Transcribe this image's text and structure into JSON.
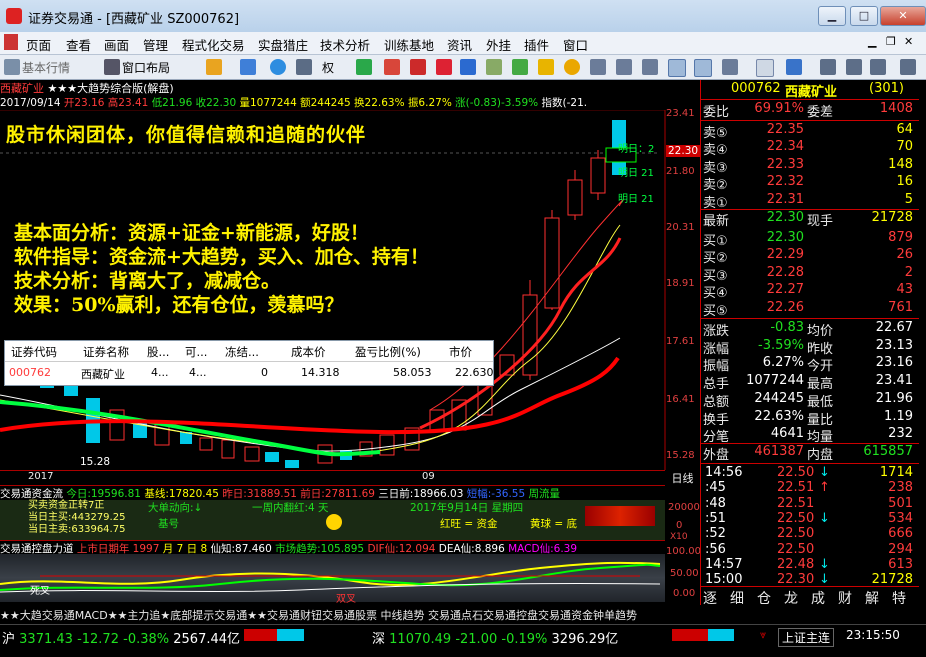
{
  "window": {
    "app_title": "证券交易通",
    "doc_title": "[西藏矿业 SZ000762]"
  },
  "menu": [
    "页面",
    "查看",
    "画面",
    "管理",
    "程式化交易",
    "实盘猎庄",
    "技术分析",
    "训练基地",
    "资讯",
    "外挂",
    "插件",
    "窗口"
  ],
  "toolbar": {
    "basic_quotes": "基本行情",
    "window_layout": "窗口布局",
    "right_label": "权"
  },
  "chart": {
    "header_name": "西藏矿业",
    "header_rest": "★★★大趋势综合版(解盘)",
    "date": "2017/09/14",
    "open": "开23.16",
    "high": "高23.41",
    "low": "低21.96",
    "close": "收22.30",
    "vol": "量1077244",
    "amt": "额244245",
    "turn": "换22.63%",
    "amp": "振6.27%",
    "chg": "涨(-0.83)-3.59%",
    "idx": "指数(-21.",
    "overlay_line1": "股市休闲团体，你值得信赖和追随的伙伴",
    "overlay_lines": [
      "基本面分析：资源+证金+新能源，好股！",
      "软件指导：资金流+大趋势，买入、加仓、持有！",
      "技术分析：背离大了，减减仓。",
      "效果：50%赢利，还有仓位，羡慕吗？"
    ],
    "tomorrow": [
      "明日：2",
      "明日 21",
      "明日 21"
    ],
    "price_tag": "22.30",
    "y_labels": [
      "23.41",
      "21.80",
      "20.31",
      "18.91",
      "17.61",
      "16.41",
      "15.28"
    ],
    "low_label": "15.28",
    "year_label": "2017",
    "month_label": "09",
    "day_line_label": "日线",
    "vol_labels": [
      "20000",
      "0"
    ],
    "vol_label_x10": "X10",
    "osc_labels": [
      "100.00",
      "50.00",
      "0.00"
    ]
  },
  "holdings": {
    "headers": [
      "证券代码",
      "证券名称",
      "股...",
      "可...",
      "冻结...",
      "成本价",
      "盈亏比例(%)",
      "市价"
    ],
    "row": [
      "000762",
      "西藏矿业",
      "4...",
      "4...",
      "0",
      "14.318",
      "58.053",
      "22.630"
    ]
  },
  "fund_flow": {
    "title": "交易通资金流",
    "today": "今日:19596.81",
    "base": "基线:17820.45",
    "yesterday": "昨日:31889.51",
    "prev2": "前日:27811.69",
    "prev3": "三日前:18966.03",
    "surge": "短幅:-36.55",
    "cycle": "周流量",
    "lines": [
      "买卖资金正转7正",
      "当日主买:443279.25",
      "当日主卖:633964.75"
    ],
    "daily_dir": "大单动向:↓",
    "week": "一周内翻红:4 天",
    "date": "2017年9月14日 星期四",
    "base2": "基号",
    "red_flag": "红旺 = 资金",
    "yellow_flag": "黄球 = 底"
  },
  "macd": {
    "title": "交易通控盘力道",
    "peak": "上市日期年 1997",
    "month": "月 7",
    "day": "日 8",
    "know": "仙知:87.460",
    "trend": "市场趋势:105.895",
    "dif": "DIF仙:12.094",
    "dea": "DEA仙:8.896",
    "macd": "MACD仙:6.39",
    "tag1": "死叉",
    "tag2": "双叉"
  },
  "scroll_ticker": "★★大趋交易通MACD★★主力追★底部提示交易通★★交易通财钮交易通股票 中线趋势 交易通点石交易通控盘交易通资金钟单趋势",
  "quote": {
    "code": "000762",
    "name": "西藏矿业",
    "sector": "(301)",
    "weibi_label": "委比",
    "weibi_val": "69.91%",
    "weicha_label": "委差",
    "weicha_val": "1408",
    "sells": [
      [
        "卖⑤",
        "22.35",
        "64"
      ],
      [
        "卖④",
        "22.34",
        "70"
      ],
      [
        "卖③",
        "22.33",
        "148"
      ],
      [
        "卖②",
        "22.32",
        "16"
      ],
      [
        "卖①",
        "22.31",
        "5"
      ]
    ],
    "latest_label": "最新",
    "latest": "22.30",
    "xianshou_label": "现手",
    "xianshou": "21728",
    "buys": [
      [
        "买①",
        "22.30",
        "879"
      ],
      [
        "买②",
        "22.29",
        "26"
      ],
      [
        "买③",
        "22.28",
        "2"
      ],
      [
        "买④",
        "22.27",
        "43"
      ],
      [
        "买⑤",
        "22.26",
        "761"
      ]
    ],
    "stats": [
      [
        "涨跌",
        "-0.83",
        "均价",
        "22.67"
      ],
      [
        "涨幅",
        "-3.59%",
        "昨收",
        "23.13"
      ],
      [
        "振幅",
        "6.27%",
        "今开",
        "23.16"
      ],
      [
        "总手",
        "1077244",
        "最高",
        "23.41"
      ],
      [
        "总额",
        "244245",
        "最低",
        "21.96"
      ],
      [
        "换手",
        "22.63%",
        "量比",
        "1.19"
      ],
      [
        "分笔",
        "4641",
        "均量",
        "232"
      ]
    ],
    "outer_label": "外盘",
    "outer": "461387",
    "inner_label": "内盘",
    "inner": "615857",
    "ticks": [
      [
        "14:56",
        "22.50",
        "↓",
        "1714"
      ],
      [
        ":45",
        "22.51",
        "↑",
        "238"
      ],
      [
        ":48",
        "22.51",
        "",
        "501"
      ],
      [
        ":51",
        "22.50",
        "↓",
        "534"
      ],
      [
        ":52",
        "22.50",
        "",
        "666"
      ],
      [
        ":56",
        "22.50",
        "",
        "294"
      ],
      [
        "14:57",
        "22.48",
        "↓",
        "613"
      ],
      [
        "15:00",
        "22.30",
        "↓",
        "21728"
      ]
    ],
    "tabs": [
      "逐",
      "细",
      "仓",
      "龙",
      "成",
      "财",
      "解",
      "特"
    ]
  },
  "status": {
    "sh_label": "沪",
    "sh_idx": "3371.43",
    "sh_chg": "-12.72",
    "sh_pct": "-0.38%",
    "sh_amt": "2567.44亿",
    "sz_label": "深",
    "sz_idx": "11070.49",
    "sz_chg": "-21.00",
    "sz_pct": "-0.19%",
    "sz_amt": "3296.29亿",
    "conn": "上证主连",
    "time": "23:15:50"
  }
}
